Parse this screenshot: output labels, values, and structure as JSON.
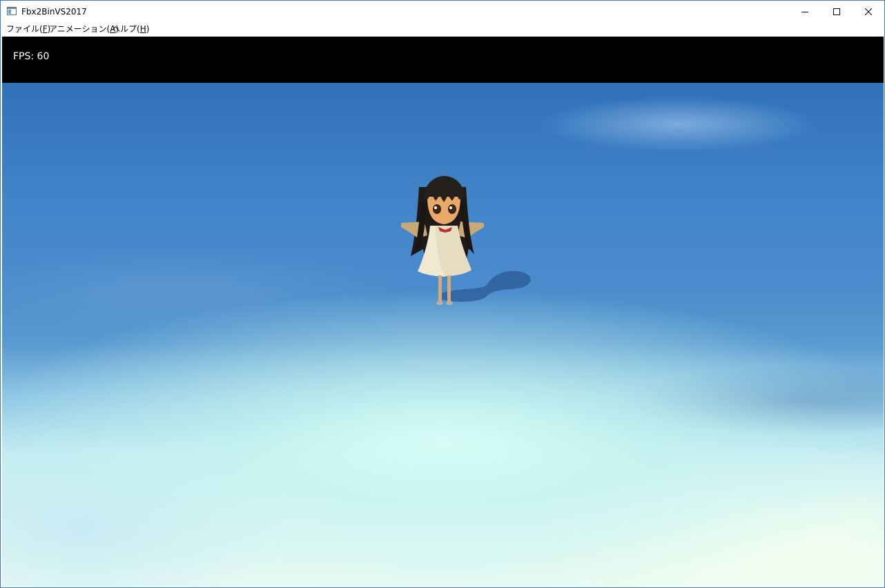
{
  "window": {
    "title": "Fbx2BinVS2017",
    "icon": "app-window-icon",
    "controls": {
      "minimize": "minimize-icon",
      "maximize": "maximize-icon",
      "close": "close-icon"
    }
  },
  "menu": {
    "items": [
      {
        "label": "ファイル(",
        "mnemonic": "F",
        "close": ")"
      },
      {
        "label": "アニメーション(",
        "mnemonic": "A",
        "close": ")"
      },
      {
        "label": "ヘルプ(",
        "mnemonic": "H",
        "close": ")"
      }
    ]
  },
  "viewport": {
    "fps_text": "FPS: 60",
    "colors": {
      "hud_background": "#000000",
      "sky_top": "#3070b8",
      "sky_bottom": "#e8faf2",
      "border_accent": "#3c78c8"
    }
  }
}
